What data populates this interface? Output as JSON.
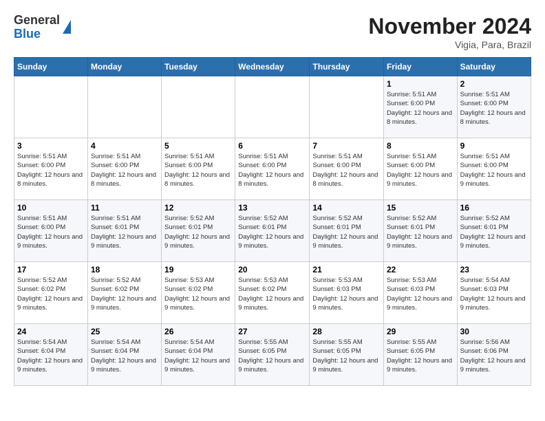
{
  "header": {
    "logo_general": "General",
    "logo_blue": "Blue",
    "month_title": "November 2024",
    "location": "Vigia, Para, Brazil"
  },
  "weekdays": [
    "Sunday",
    "Monday",
    "Tuesday",
    "Wednesday",
    "Thursday",
    "Friday",
    "Saturday"
  ],
  "weeks": [
    [
      {
        "day": "",
        "info": ""
      },
      {
        "day": "",
        "info": ""
      },
      {
        "day": "",
        "info": ""
      },
      {
        "day": "",
        "info": ""
      },
      {
        "day": "",
        "info": ""
      },
      {
        "day": "1",
        "info": "Sunrise: 5:51 AM\nSunset: 6:00 PM\nDaylight: 12 hours and 8 minutes."
      },
      {
        "day": "2",
        "info": "Sunrise: 5:51 AM\nSunset: 6:00 PM\nDaylight: 12 hours and 8 minutes."
      }
    ],
    [
      {
        "day": "3",
        "info": "Sunrise: 5:51 AM\nSunset: 6:00 PM\nDaylight: 12 hours and 8 minutes."
      },
      {
        "day": "4",
        "info": "Sunrise: 5:51 AM\nSunset: 6:00 PM\nDaylight: 12 hours and 8 minutes."
      },
      {
        "day": "5",
        "info": "Sunrise: 5:51 AM\nSunset: 6:00 PM\nDaylight: 12 hours and 8 minutes."
      },
      {
        "day": "6",
        "info": "Sunrise: 5:51 AM\nSunset: 6:00 PM\nDaylight: 12 hours and 8 minutes."
      },
      {
        "day": "7",
        "info": "Sunrise: 5:51 AM\nSunset: 6:00 PM\nDaylight: 12 hours and 8 minutes."
      },
      {
        "day": "8",
        "info": "Sunrise: 5:51 AM\nSunset: 6:00 PM\nDaylight: 12 hours and 9 minutes."
      },
      {
        "day": "9",
        "info": "Sunrise: 5:51 AM\nSunset: 6:00 PM\nDaylight: 12 hours and 9 minutes."
      }
    ],
    [
      {
        "day": "10",
        "info": "Sunrise: 5:51 AM\nSunset: 6:00 PM\nDaylight: 12 hours and 9 minutes."
      },
      {
        "day": "11",
        "info": "Sunrise: 5:51 AM\nSunset: 6:01 PM\nDaylight: 12 hours and 9 minutes."
      },
      {
        "day": "12",
        "info": "Sunrise: 5:52 AM\nSunset: 6:01 PM\nDaylight: 12 hours and 9 minutes."
      },
      {
        "day": "13",
        "info": "Sunrise: 5:52 AM\nSunset: 6:01 PM\nDaylight: 12 hours and 9 minutes."
      },
      {
        "day": "14",
        "info": "Sunrise: 5:52 AM\nSunset: 6:01 PM\nDaylight: 12 hours and 9 minutes."
      },
      {
        "day": "15",
        "info": "Sunrise: 5:52 AM\nSunset: 6:01 PM\nDaylight: 12 hours and 9 minutes."
      },
      {
        "day": "16",
        "info": "Sunrise: 5:52 AM\nSunset: 6:01 PM\nDaylight: 12 hours and 9 minutes."
      }
    ],
    [
      {
        "day": "17",
        "info": "Sunrise: 5:52 AM\nSunset: 6:02 PM\nDaylight: 12 hours and 9 minutes."
      },
      {
        "day": "18",
        "info": "Sunrise: 5:52 AM\nSunset: 6:02 PM\nDaylight: 12 hours and 9 minutes."
      },
      {
        "day": "19",
        "info": "Sunrise: 5:53 AM\nSunset: 6:02 PM\nDaylight: 12 hours and 9 minutes."
      },
      {
        "day": "20",
        "info": "Sunrise: 5:53 AM\nSunset: 6:02 PM\nDaylight: 12 hours and 9 minutes."
      },
      {
        "day": "21",
        "info": "Sunrise: 5:53 AM\nSunset: 6:03 PM\nDaylight: 12 hours and 9 minutes."
      },
      {
        "day": "22",
        "info": "Sunrise: 5:53 AM\nSunset: 6:03 PM\nDaylight: 12 hours and 9 minutes."
      },
      {
        "day": "23",
        "info": "Sunrise: 5:54 AM\nSunset: 6:03 PM\nDaylight: 12 hours and 9 minutes."
      }
    ],
    [
      {
        "day": "24",
        "info": "Sunrise: 5:54 AM\nSunset: 6:04 PM\nDaylight: 12 hours and 9 minutes."
      },
      {
        "day": "25",
        "info": "Sunrise: 5:54 AM\nSunset: 6:04 PM\nDaylight: 12 hours and 9 minutes."
      },
      {
        "day": "26",
        "info": "Sunrise: 5:54 AM\nSunset: 6:04 PM\nDaylight: 12 hours and 9 minutes."
      },
      {
        "day": "27",
        "info": "Sunrise: 5:55 AM\nSunset: 6:05 PM\nDaylight: 12 hours and 9 minutes."
      },
      {
        "day": "28",
        "info": "Sunrise: 5:55 AM\nSunset: 6:05 PM\nDaylight: 12 hours and 9 minutes."
      },
      {
        "day": "29",
        "info": "Sunrise: 5:55 AM\nSunset: 6:05 PM\nDaylight: 12 hours and 9 minutes."
      },
      {
        "day": "30",
        "info": "Sunrise: 5:56 AM\nSunset: 6:06 PM\nDaylight: 12 hours and 9 minutes."
      }
    ]
  ]
}
